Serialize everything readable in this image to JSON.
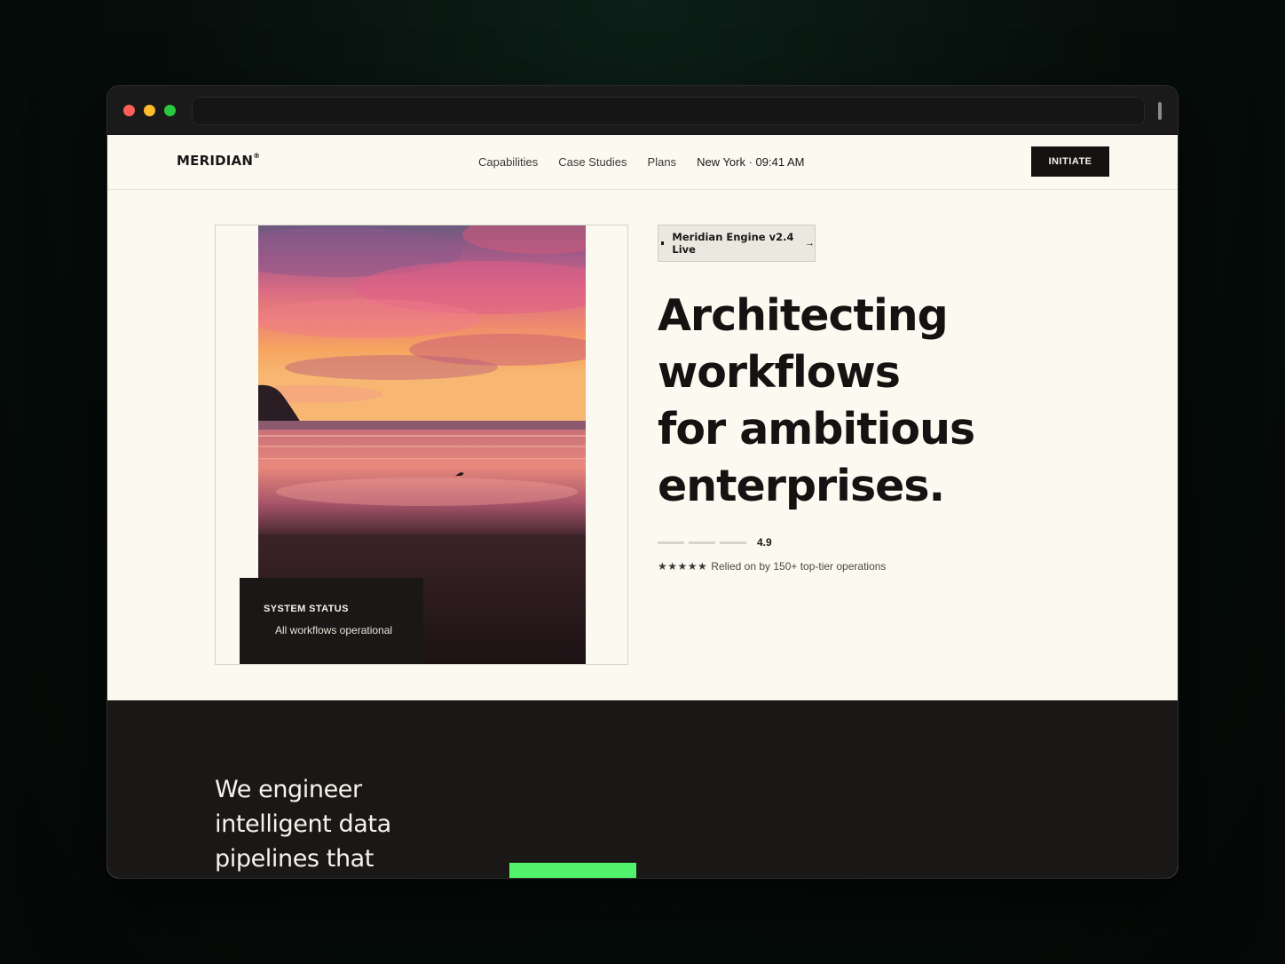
{
  "browser": {
    "url": ""
  },
  "nav": {
    "logo": "MERIDIAN",
    "logo_mark": "®",
    "links": [
      "Capabilities",
      "Case Studies",
      "Plans"
    ],
    "clock": "New York · 09:41 AM",
    "cta": "INITIATE"
  },
  "hero": {
    "badge": "Meridian Engine v2.4 Live",
    "badge_icon": "arrow-right-icon",
    "headline_lines": [
      "Architecting",
      "workflows",
      "for ambitious",
      "enterprises."
    ],
    "rating": {
      "score": "4.9",
      "stars": "★★★★★",
      "caption": "Relied on by 150+ top-tier operations"
    },
    "status_card": {
      "title": "SYSTEM STATUS",
      "text": "All workflows operational"
    }
  },
  "section2": {
    "headline": "We engineer intelligent data pipelines that"
  },
  "colors": {
    "accent_green": "#52f26c",
    "dark": "#1a1817",
    "cream": "#fcfaf0"
  }
}
